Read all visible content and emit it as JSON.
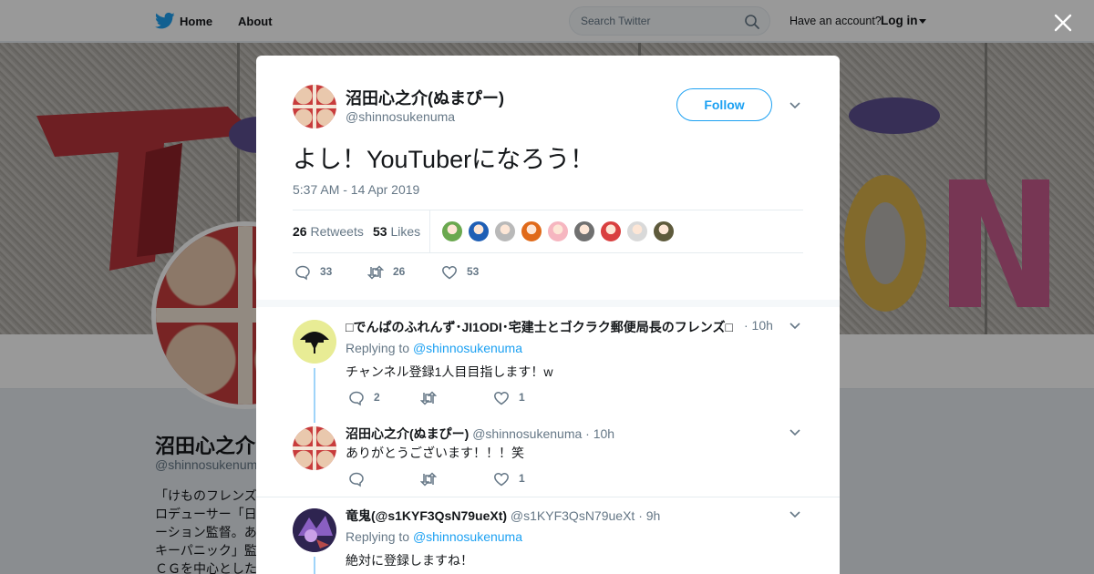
{
  "nav": {
    "home": "Home",
    "about": "About",
    "search_placeholder": "Search Twitter",
    "account_prompt": "Have an account?",
    "login": "Log in"
  },
  "profile": {
    "name": "沼田心之介(ぬまぴー)",
    "handle": "@shinnosukenuma",
    "bio_lines": [
      "「けものフレンズ",
      "ロデューサー「日",
      "ーション監督。あ",
      "キーパニック」監",
      "ＣＧを中心とした"
    ]
  },
  "tweet": {
    "author_name": "沼田心之介(ぬまぴー)",
    "author_handle": "@shinnosukenuma",
    "follow_label": "Follow",
    "text": "よし！YouTuberになろう！",
    "timestamp": "5:37 AM - 14 Apr 2019",
    "retweets_count": "26",
    "retweets_label": "Retweets",
    "likes_count": "53",
    "likes_label": "Likes",
    "actions": {
      "replies": "33",
      "retweets": "26",
      "likes": "53"
    }
  },
  "likers": [
    "#6aa84f",
    "#1f5fb5",
    "#b9b9b9",
    "#e06a1a",
    "#f6b6c0",
    "#707070",
    "#d94040",
    "#d9d9d9",
    "#5e5a3c"
  ],
  "replies": [
    {
      "name": "□でんぱのふれんず･JI1ODI･宅建士とゴクラク郵便局長のフレンズ□ ▯",
      "time": "· 10h",
      "replying_label": "Replying to",
      "replying_to": "@shinnosukenuma",
      "text": "チャンネル登録1人目目指します！w",
      "reply_count": "2",
      "retweet_count": "",
      "like_count": "1"
    },
    {
      "name": "沼田心之介(ぬまぴー)",
      "handle": "@shinnosukenuma",
      "time": "· 10h",
      "text": "ありがとうございます！！！笑",
      "reply_count": "",
      "retweet_count": "",
      "like_count": "1"
    },
    {
      "name": "竜鬼(@s1KYF3QsN79ueXt)",
      "handle": "@s1KYF3QsN79ueXt",
      "time": "· 9h",
      "replying_label": "Replying to",
      "replying_to": "@shinnosukenuma",
      "text": "絶対に登録しますね！"
    }
  ],
  "colors": {
    "accent": "#1da1f2",
    "text": "#14171a",
    "muted": "#657786",
    "thread": "#9fd4f9"
  }
}
